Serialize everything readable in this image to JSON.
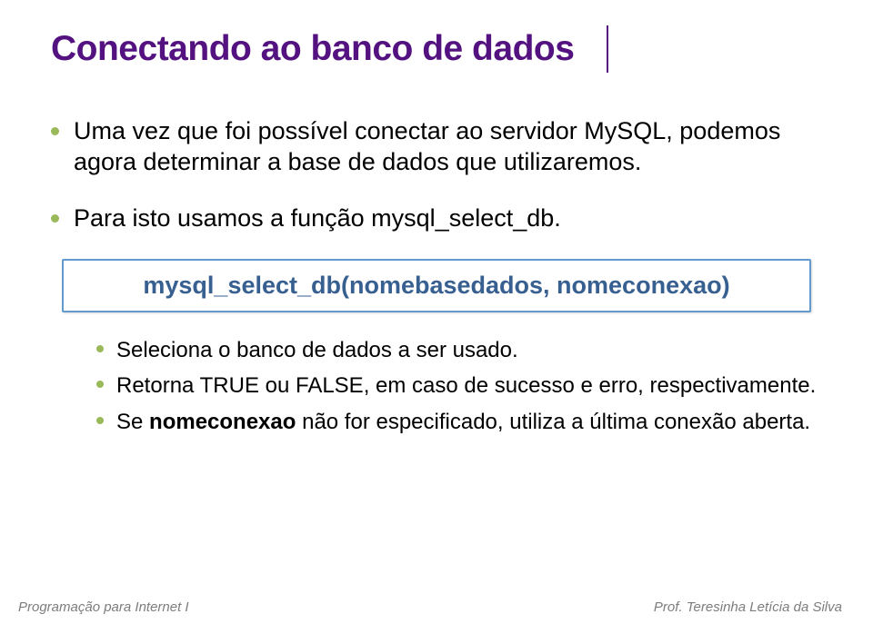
{
  "title": "Conectando ao banco de dados",
  "bullets": [
    "Uma vez que foi possível conectar ao servidor MySQL, podemos agora determinar a base de dados que utilizaremos.",
    "Para isto usamos a função mysql_select_db."
  ],
  "code": "mysql_select_db(nomebasedados, nomeconexao)",
  "sub": [
    {
      "pre": "Seleciona o banco de dados a ser usado.",
      "bold": "",
      "post": ""
    },
    {
      "pre": "Retorna TRUE ou FALSE, em caso de sucesso e erro, respectivamente.",
      "bold": "",
      "post": ""
    },
    {
      "pre": "Se ",
      "bold": "nomeconexao",
      "post": " não for especificado, utiliza a última conexão aberta."
    }
  ],
  "footer": {
    "left": "Programação para Internet I",
    "right": "Prof. Teresinha Letícia da Silva"
  }
}
